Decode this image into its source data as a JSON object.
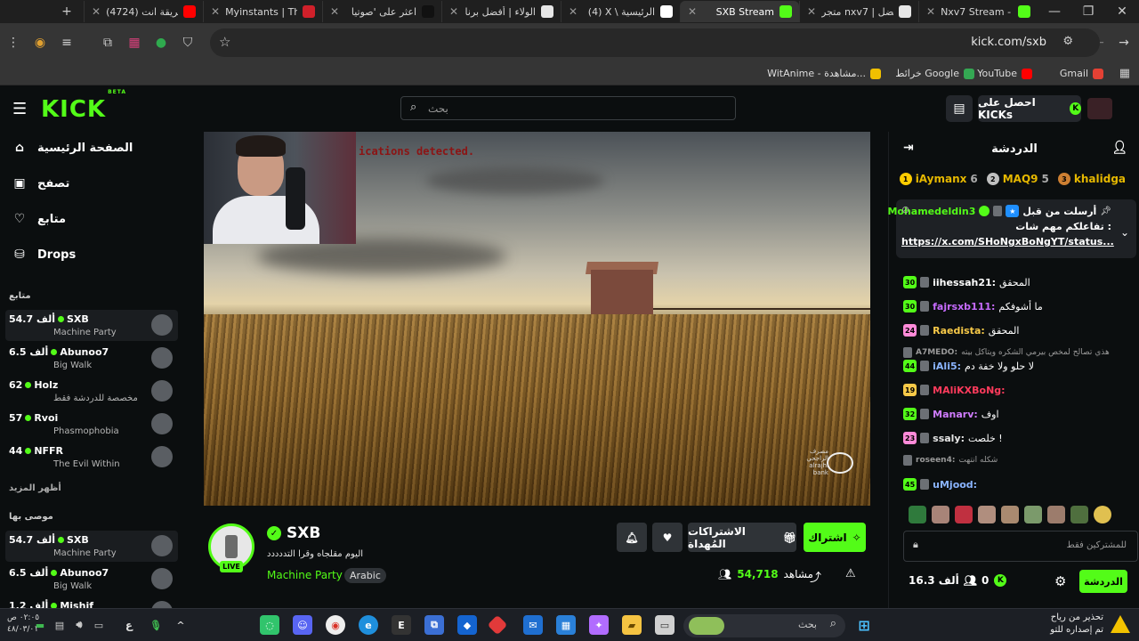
{
  "browser": {
    "tabs": [
      {
        "title": "Nxv7 Stream - W",
        "fav_color": "#53fc18",
        "active": false
      },
      {
        "title": "متجر nxv7 | أفضل",
        "fav_color": "#e6e6e6",
        "active": false
      },
      {
        "title": "SXB Stream",
        "fav_color": "#53fc18",
        "active": true
      },
      {
        "title": "(4) X \\ الرئيسية",
        "fav_color": "#ffffff",
        "active": false
      },
      {
        "title": "الولاء | أفضل برنا",
        "fav_color": "#e6e6e6",
        "active": false
      },
      {
        "title": "اعثر على 'صوتيا",
        "fav_color": "#111111",
        "active": false
      },
      {
        "title": "Myinstants | The",
        "fav_color": "#d0202a",
        "active": false
      },
      {
        "title": "(4724) طريقة انت",
        "fav_color": "#ff0000",
        "active": false
      }
    ],
    "new_tab": "+",
    "url": "kick.com/sxb",
    "bookmarks": [
      {
        "label": "Gmail",
        "color": "#e44134"
      },
      {
        "label": "YouTube",
        "color": "#ff0000"
      },
      {
        "label": "خرائط Google",
        "color": "#34a853"
      },
      {
        "label": "WitAnime - مشاهدة...",
        "color": "#f0c000"
      }
    ]
  },
  "kick": {
    "logo": "KICK",
    "logo_beta": "BETA",
    "search_placeholder": "بحث",
    "get_kicks": "احصل على KICKs",
    "nav": [
      {
        "label": "الصفحة الرئيسية",
        "icon": "home-icon"
      },
      {
        "label": "تصفح",
        "icon": "browse-icon"
      },
      {
        "label": "متابع",
        "icon": "heart-icon"
      },
      {
        "label": "Drops",
        "icon": "drops-icon"
      }
    ],
    "following_header": "متابع",
    "following": [
      {
        "viewers": "54.7 ألف",
        "name": "SXB",
        "category": "Machine Party",
        "highlight": true
      },
      {
        "viewers": "6.5 ألف",
        "name": "Abunoo7",
        "category": "Big Walk",
        "highlight": false
      },
      {
        "viewers": "62",
        "name": "Holz",
        "category": "مخصصة للدردشة فقط",
        "highlight": false
      },
      {
        "viewers": "57",
        "name": "Rvoi",
        "category": "Phasmophobia",
        "highlight": false
      },
      {
        "viewers": "44",
        "name": "NFFR",
        "category": "The Evil Within",
        "highlight": false
      }
    ],
    "show_more": "أظهر المزيد",
    "recommended_header": "موصى بها",
    "recommended": [
      {
        "viewers": "54.7 ألف",
        "name": "SXB",
        "category": "Machine Party",
        "highlight": true
      },
      {
        "viewers": "6.5 ألف",
        "name": "Abunoo7",
        "category": "Big Walk",
        "highlight": false
      },
      {
        "viewers": "1.2 ألف",
        "name": "Mishif",
        "category": "",
        "highlight": false
      }
    ]
  },
  "video": {
    "overlay_text": "ications detected.",
    "watermark": "مصرف الراجحي alrajhi bank"
  },
  "stream": {
    "streamer": "SXB",
    "title": "اليوم مقلجاه وقرا التددددد",
    "category": "Machine Party",
    "language": "Arabic",
    "live": "LIVE",
    "subscribe": "اشتراك",
    "gift_subs": "الاشتراكات المُهداة",
    "viewers": "54,718",
    "viewers_label": "مشاهد"
  },
  "chat": {
    "title": "الدردشة",
    "leaders": [
      {
        "name": "khalidga",
        "count": "",
        "rank": "3",
        "color": "#cd7f32"
      },
      {
        "name": "MAQ9",
        "count": "5",
        "rank": "2",
        "color": "#c0c0c0"
      },
      {
        "name": "iAymanx",
        "count": "6",
        "rank": "1",
        "color": "#ffcc00"
      }
    ],
    "pinned": {
      "label": "أرسلت من قبل",
      "user": "Mohamedeldin3",
      "text": "تفاعلكم مهم شات :",
      "link": "https://x.com/SHoNgxBoNgYT/status..."
    },
    "messages": [
      {
        "badge": "30",
        "badge_color": "#53fc18",
        "user": "iihessah21:",
        "user_color": "#ffffff",
        "text": "المحقق"
      },
      {
        "badge": "30",
        "badge_color": "#53fc18",
        "user": "fajrsxb111:",
        "user_color": "#c76bff",
        "text": "ما أشوفكم"
      },
      {
        "badge": "24",
        "badge_color": "#ff8ad8",
        "user": "Raedista:",
        "user_color": "#f7c948",
        "text": "المحقق"
      },
      {
        "badge": "",
        "badge_color": "",
        "user": "A7MEDO:",
        "user_color": "#9a9a9a",
        "text": "هذي تصالح لمخص بيرمي الشكره ويتاكل بيته"
      },
      {
        "badge": "44",
        "badge_color": "#53fc18",
        "user": "iAli5:",
        "user_color": "#8ab4ff",
        "text": "لا حلو ولا خفة دم"
      },
      {
        "badge": "19",
        "badge_color": "#f7c948",
        "user": "MAliKXBoNg:",
        "user_color": "#ff3b5c",
        "text": ""
      },
      {
        "badge": "32",
        "badge_color": "#53fc18",
        "user": "Manarv:",
        "user_color": "#d07cff",
        "text": "اوف"
      },
      {
        "badge": "23",
        "badge_color": "#ff8ad8",
        "user": "ssaly:",
        "user_color": "#e6e6e6",
        "text": "خلصت !"
      },
      {
        "badge": "",
        "badge_color": "",
        "user": "roseen4:",
        "user_color": "#4fd1c5",
        "text": "شكله انتهت"
      },
      {
        "badge": "45",
        "badge_color": "#53fc18",
        "user": "uMjood:",
        "user_color": "#8ab4ff",
        "text": ""
      }
    ],
    "input_placeholder": "للمشتركين فقط",
    "kicks_balance": "0",
    "followers": "16.3 ألف",
    "send": "الدردشة"
  },
  "taskbar": {
    "search_placeholder": "بحث",
    "time": "٠٢:٠٥ ص",
    "date": "٤٨/٠٣/٠١",
    "lang": "ع",
    "notif_title": "تحذير من رياح",
    "notif_sub": "تم إصداره للتو"
  }
}
